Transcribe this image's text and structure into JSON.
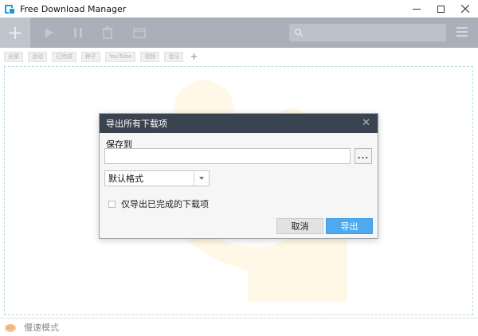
{
  "window": {
    "title": "Free Download Manager",
    "minimize_icon": "minimize-icon",
    "maximize_icon": "maximize-icon",
    "close_icon": "close-icon"
  },
  "toolbar": {
    "add_label": "+",
    "icons": [
      "play-icon",
      "pause-icon",
      "remove-icon",
      "move-icon"
    ],
    "search_placeholder": "",
    "search_icon": "search-icon",
    "menu_icon": "hamburger-menu-icon"
  },
  "filters": {
    "tabs": [
      {
        "label": "全部"
      },
      {
        "label": "活动"
      },
      {
        "label": "已完成"
      },
      {
        "label": "种子"
      },
      {
        "label": "YouTube"
      },
      {
        "label": "视频"
      },
      {
        "label": "音乐"
      }
    ],
    "add_label": "+"
  },
  "dialog": {
    "title": "导出所有下载项",
    "save_to_label": "保存到",
    "path_value": "",
    "browse_label": "...",
    "format_value": "默认格式",
    "checkbox_label": "仅导出已完成的下载项",
    "checkbox_checked": false,
    "cancel_label": "取消",
    "export_label": "导出"
  },
  "status": {
    "mode_label": "慢速模式",
    "mode_icon": "turtle-icon"
  },
  "colors": {
    "toolbar_bg": "#a9b0b9",
    "dialog_header": "#3a4350",
    "accent": "#4ea9ee"
  }
}
